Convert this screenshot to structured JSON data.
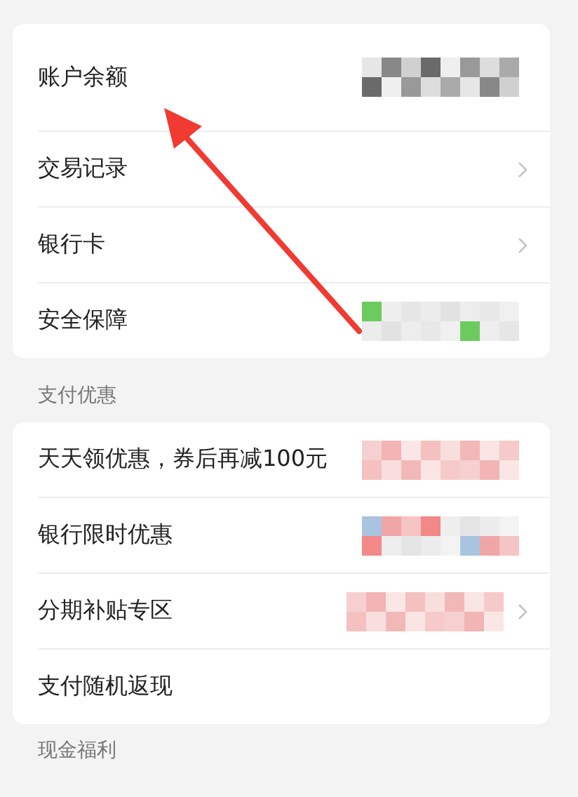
{
  "account_card": {
    "rows": [
      {
        "label": "账户余额",
        "chevron": false,
        "kind": "redacted_gray"
      },
      {
        "label": "交易记录",
        "chevron": true,
        "kind": "plain"
      },
      {
        "label": "银行卡",
        "chevron": true,
        "kind": "plain"
      },
      {
        "label": "安全保障",
        "chevron": false,
        "kind": "redacted_green"
      }
    ]
  },
  "offers_section": {
    "title": "支付优惠",
    "rows": [
      {
        "label": "天天领优惠，券后再减100元",
        "chevron": false,
        "kind": "redacted_pink"
      },
      {
        "label": "银行限时优惠",
        "chevron": false,
        "kind": "redacted_blue"
      },
      {
        "label": "分期补贴专区",
        "chevron": true,
        "kind": "redacted_pink"
      },
      {
        "label": "支付随机返现",
        "chevron": false,
        "kind": "plain"
      }
    ]
  },
  "next_section": {
    "title": "现金福利"
  }
}
